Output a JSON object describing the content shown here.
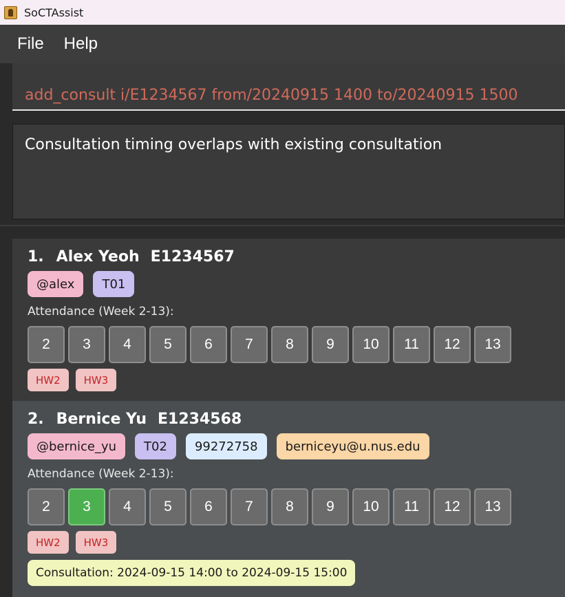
{
  "window": {
    "title": "SoCTAssist",
    "icon": "app-icon"
  },
  "menu": {
    "items": [
      "File",
      "Help"
    ]
  },
  "command": {
    "value": "add_consult i/E1234567 from/20240915 1400 to/20240915 1500"
  },
  "result": {
    "message": "Consultation timing overlaps with existing consultation"
  },
  "students": [
    {
      "index": "1.",
      "name": "Alex Yeoh",
      "student_id": "E1234567",
      "telegram": "@alex",
      "tutorial": "T01",
      "attendance_label": "Attendance (Week 2-13):",
      "weeks": [
        "2",
        "3",
        "4",
        "5",
        "6",
        "7",
        "8",
        "9",
        "10",
        "11",
        "12",
        "13"
      ],
      "present_weeks": [],
      "homework": [
        "HW2",
        "HW3"
      ]
    },
    {
      "index": "2.",
      "name": "Bernice Yu",
      "student_id": "E1234568",
      "telegram": "@bernice_yu",
      "tutorial": "T02",
      "phone": "99272758",
      "email": "berniceyu@u.nus.edu",
      "attendance_label": "Attendance (Week 2-13):",
      "weeks": [
        "2",
        "3",
        "4",
        "5",
        "6",
        "7",
        "8",
        "9",
        "10",
        "11",
        "12",
        "13"
      ],
      "present_weeks": [
        "3"
      ],
      "homework": [
        "HW2",
        "HW3"
      ],
      "consultation": "Consultation: 2024-09-15 14:00 to 2024-09-15 15:00"
    }
  ],
  "colors": {
    "present": "#4caf50",
    "absent": "#6b6b6b",
    "command_text": "#d06a5a"
  }
}
